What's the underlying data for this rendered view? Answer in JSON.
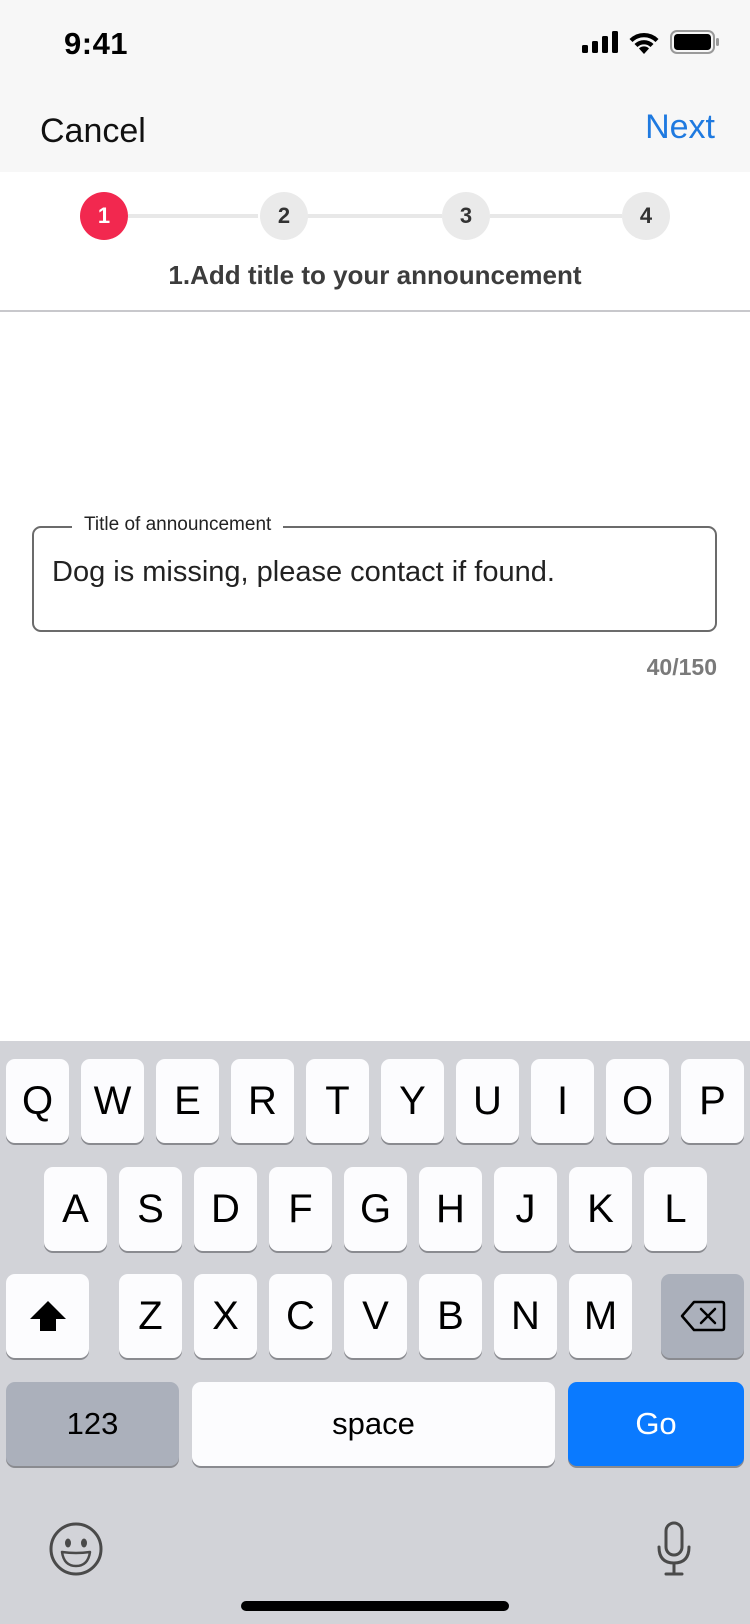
{
  "status_bar": {
    "time": "9:41",
    "icons": [
      "cellular-icon",
      "wifi-icon",
      "battery-icon"
    ]
  },
  "nav": {
    "cancel_label": "Cancel",
    "next_label": "Next"
  },
  "stepper": {
    "steps": [
      "1",
      "2",
      "3",
      "4"
    ],
    "active_step": 1,
    "caption": "1.Add title to your announcement"
  },
  "field": {
    "label": "Title of announcement",
    "value": "Dog is missing, please contact if found.",
    "counter": "40/150"
  },
  "keyboard": {
    "rows": [
      [
        "Q",
        "W",
        "E",
        "R",
        "T",
        "Y",
        "U",
        "I",
        "O",
        "P"
      ],
      [
        "A",
        "S",
        "D",
        "F",
        "G",
        "H",
        "J",
        "K",
        "L"
      ],
      [
        "Z",
        "X",
        "C",
        "V",
        "B",
        "N",
        "M"
      ]
    ],
    "numbers_label": "123",
    "space_label": "space",
    "go_label": "Go",
    "icons": [
      "shift-icon",
      "backspace-icon",
      "emoji-icon",
      "microphone-icon"
    ]
  },
  "colors": {
    "accent": "#1f7ae0",
    "step_active": "#f2284f",
    "go_key": "#0a7aff"
  }
}
